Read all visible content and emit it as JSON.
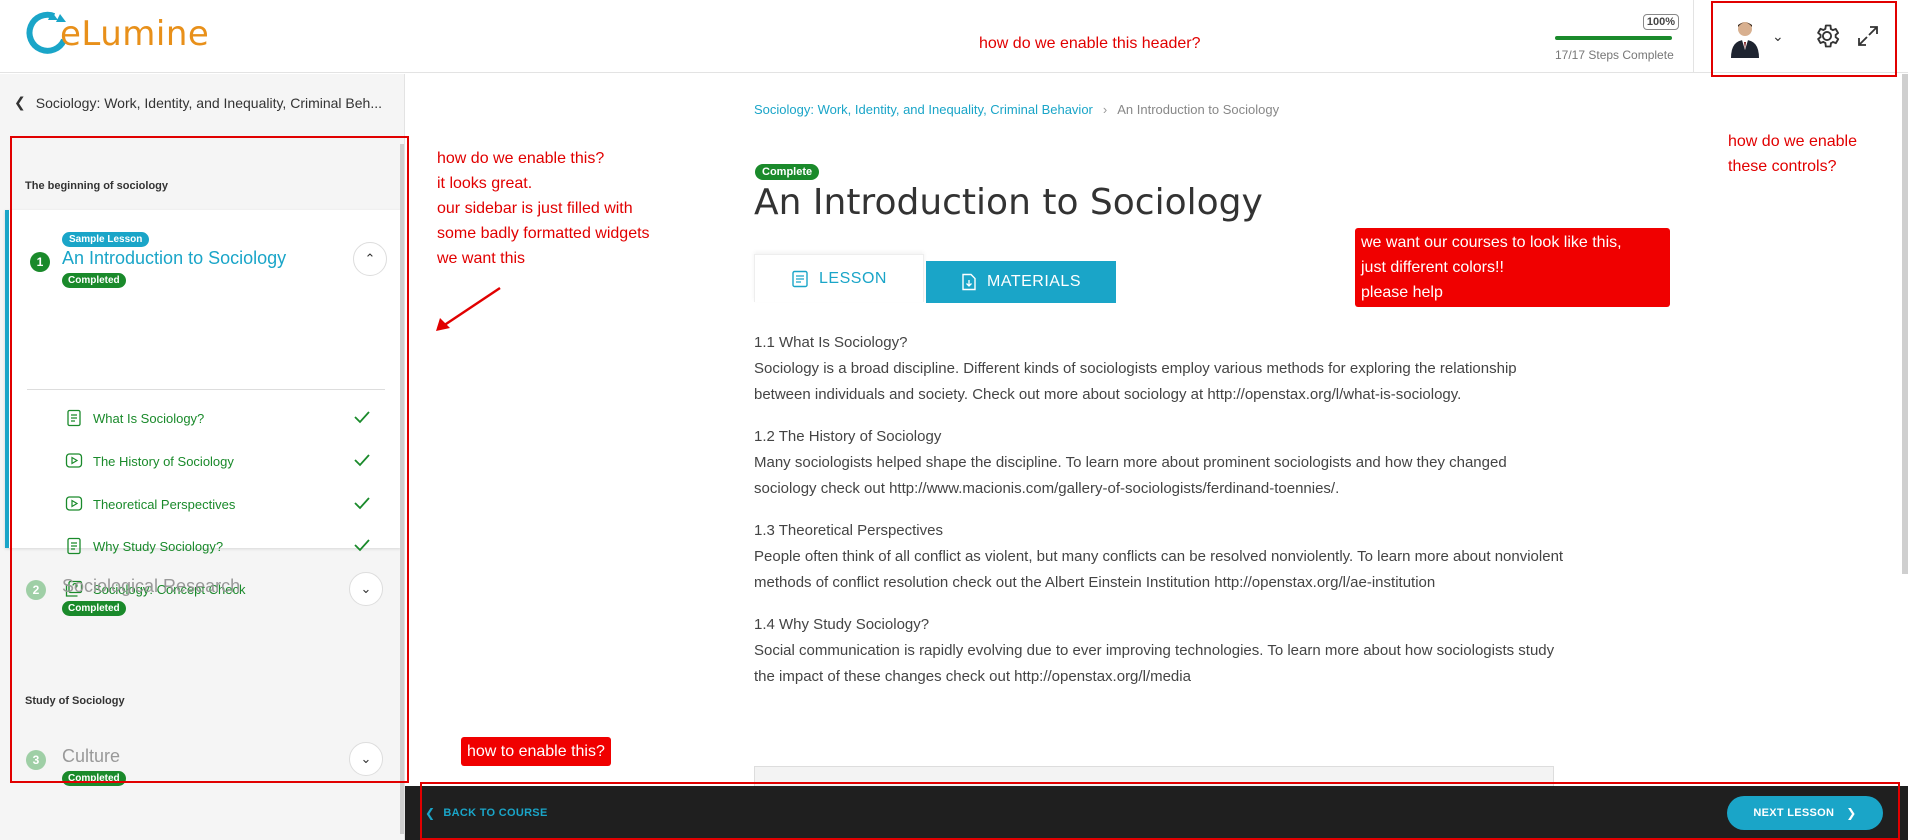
{
  "header": {
    "logo_text": "eLumine",
    "progress_percent_label": "100%",
    "progress_fraction": 1.0,
    "progress_text": "17/17 Steps Complete"
  },
  "sidebar": {
    "back_label": "Sociology: Work, Identity, and Inequality, Criminal Beh...",
    "sections": [
      {
        "title": "The beginning of sociology"
      },
      {
        "title": "Study of Sociology"
      }
    ],
    "lessons": [
      {
        "number": "1",
        "title": "An Introduction to Sociology",
        "sample_badge": "Sample Lesson",
        "status": "Completed"
      },
      {
        "number": "2",
        "title": "Sociological Research",
        "status": "Completed"
      },
      {
        "number": "3",
        "title": "Culture",
        "status": "Completed"
      }
    ],
    "topics": [
      {
        "label": "What Is Sociology?",
        "icon": "document-icon"
      },
      {
        "label": "The History of Sociology",
        "icon": "video-icon"
      },
      {
        "label": "Theoretical Perspectives",
        "icon": "video-icon"
      },
      {
        "label": "Why Study Sociology?",
        "icon": "document-icon"
      },
      {
        "label": "Sociology: Concept Check",
        "icon": "quiz-icon"
      }
    ]
  },
  "main": {
    "breadcrumb_course": "Sociology: Work, Identity, and Inequality, Criminal Behavior",
    "breadcrumb_current": "An Introduction to Sociology",
    "status_tag": "Complete",
    "title": "An Introduction to Sociology",
    "tabs": [
      {
        "label": "LESSON"
      },
      {
        "label": "MATERIALS"
      }
    ],
    "paragraphs": [
      {
        "heading": "1.1 What Is Sociology?",
        "text": "Sociology is a broad discipline. Different kinds of sociologists employ various methods for exploring the relationship between individuals and society. Check out more about sociology at http://openstax.org/l/what-is-sociology."
      },
      {
        "heading": "1.2 The History of Sociology",
        "text": "Many sociologists helped shape the discipline. To learn more about prominent sociologists and how they changed sociology check out http://www.macionis.com/gallery-of-sociologists/ferdinand-toennies/."
      },
      {
        "heading": "1.3 Theoretical Perspectives",
        "text": "People often think of all conflict as violent, but many conflicts can be resolved nonviolently. To learn more about nonviolent methods of conflict resolution check out the Albert Einstein Institution http://openstax.org/l/ae-institution"
      },
      {
        "heading": "1.4 Why Study Sociology?",
        "text": "Social communication is rapidly evolving due to ever improving technologies. To learn more about how sociologists study the impact of these changes check out http://openstax.org/l/media"
      }
    ]
  },
  "footer": {
    "back_label": "BACK TO COURSE",
    "next_label": "NEXT LESSON"
  },
  "annotations": {
    "header_note": "how do we enable this header?",
    "controls_note_1": "how do we enable",
    "controls_note_2": "these controls?",
    "sidebar_note_1": "how do we enable this?",
    "sidebar_note_2": "it looks great.",
    "sidebar_note_3": "our sidebar is just filled with",
    "sidebar_note_4": "some badly formatted widgets",
    "sidebar_note_5": "we want this",
    "courses_note_1": "we want our courses to look like this,",
    "courses_note_2": "just different colors!!",
    "courses_note_3": "please help",
    "footer_note": "how to enable this?"
  },
  "colors": {
    "accent": "#1aa5c8",
    "success": "#1a8a2b",
    "annotation": "#e10000",
    "footer_bg": "#1f1f1f"
  }
}
